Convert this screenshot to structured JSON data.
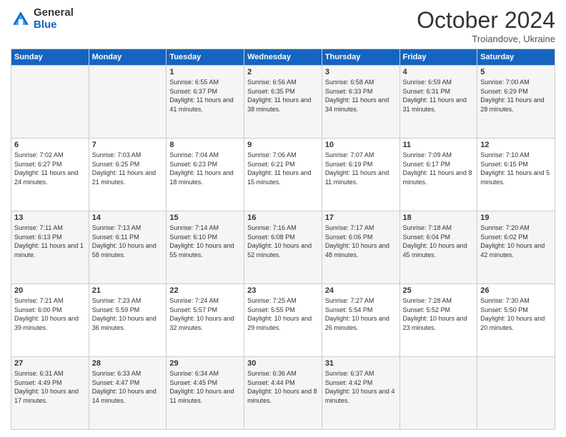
{
  "header": {
    "logo_general": "General",
    "logo_blue": "Blue",
    "month_title": "October 2024",
    "subtitle": "Troiandove, Ukraine"
  },
  "weekdays": [
    "Sunday",
    "Monday",
    "Tuesday",
    "Wednesday",
    "Thursday",
    "Friday",
    "Saturday"
  ],
  "weeks": [
    [
      {
        "day": "",
        "sunrise": "",
        "sunset": "",
        "daylight": ""
      },
      {
        "day": "",
        "sunrise": "",
        "sunset": "",
        "daylight": ""
      },
      {
        "day": "1",
        "sunrise": "Sunrise: 6:55 AM",
        "sunset": "Sunset: 6:37 PM",
        "daylight": "Daylight: 11 hours and 41 minutes."
      },
      {
        "day": "2",
        "sunrise": "Sunrise: 6:56 AM",
        "sunset": "Sunset: 6:35 PM",
        "daylight": "Daylight: 11 hours and 38 minutes."
      },
      {
        "day": "3",
        "sunrise": "Sunrise: 6:58 AM",
        "sunset": "Sunset: 6:33 PM",
        "daylight": "Daylight: 11 hours and 34 minutes."
      },
      {
        "day": "4",
        "sunrise": "Sunrise: 6:59 AM",
        "sunset": "Sunset: 6:31 PM",
        "daylight": "Daylight: 11 hours and 31 minutes."
      },
      {
        "day": "5",
        "sunrise": "Sunrise: 7:00 AM",
        "sunset": "Sunset: 6:29 PM",
        "daylight": "Daylight: 11 hours and 28 minutes."
      }
    ],
    [
      {
        "day": "6",
        "sunrise": "Sunrise: 7:02 AM",
        "sunset": "Sunset: 6:27 PM",
        "daylight": "Daylight: 11 hours and 24 minutes."
      },
      {
        "day": "7",
        "sunrise": "Sunrise: 7:03 AM",
        "sunset": "Sunset: 6:25 PM",
        "daylight": "Daylight: 11 hours and 21 minutes."
      },
      {
        "day": "8",
        "sunrise": "Sunrise: 7:04 AM",
        "sunset": "Sunset: 6:23 PM",
        "daylight": "Daylight: 11 hours and 18 minutes."
      },
      {
        "day": "9",
        "sunrise": "Sunrise: 7:06 AM",
        "sunset": "Sunset: 6:21 PM",
        "daylight": "Daylight: 11 hours and 15 minutes."
      },
      {
        "day": "10",
        "sunrise": "Sunrise: 7:07 AM",
        "sunset": "Sunset: 6:19 PM",
        "daylight": "Daylight: 11 hours and 11 minutes."
      },
      {
        "day": "11",
        "sunrise": "Sunrise: 7:09 AM",
        "sunset": "Sunset: 6:17 PM",
        "daylight": "Daylight: 11 hours and 8 minutes."
      },
      {
        "day": "12",
        "sunrise": "Sunrise: 7:10 AM",
        "sunset": "Sunset: 6:15 PM",
        "daylight": "Daylight: 11 hours and 5 minutes."
      }
    ],
    [
      {
        "day": "13",
        "sunrise": "Sunrise: 7:11 AM",
        "sunset": "Sunset: 6:13 PM",
        "daylight": "Daylight: 11 hours and 1 minute."
      },
      {
        "day": "14",
        "sunrise": "Sunrise: 7:13 AM",
        "sunset": "Sunset: 6:11 PM",
        "daylight": "Daylight: 10 hours and 58 minutes."
      },
      {
        "day": "15",
        "sunrise": "Sunrise: 7:14 AM",
        "sunset": "Sunset: 6:10 PM",
        "daylight": "Daylight: 10 hours and 55 minutes."
      },
      {
        "day": "16",
        "sunrise": "Sunrise: 7:16 AM",
        "sunset": "Sunset: 6:08 PM",
        "daylight": "Daylight: 10 hours and 52 minutes."
      },
      {
        "day": "17",
        "sunrise": "Sunrise: 7:17 AM",
        "sunset": "Sunset: 6:06 PM",
        "daylight": "Daylight: 10 hours and 48 minutes."
      },
      {
        "day": "18",
        "sunrise": "Sunrise: 7:18 AM",
        "sunset": "Sunset: 6:04 PM",
        "daylight": "Daylight: 10 hours and 45 minutes."
      },
      {
        "day": "19",
        "sunrise": "Sunrise: 7:20 AM",
        "sunset": "Sunset: 6:02 PM",
        "daylight": "Daylight: 10 hours and 42 minutes."
      }
    ],
    [
      {
        "day": "20",
        "sunrise": "Sunrise: 7:21 AM",
        "sunset": "Sunset: 6:00 PM",
        "daylight": "Daylight: 10 hours and 39 minutes."
      },
      {
        "day": "21",
        "sunrise": "Sunrise: 7:23 AM",
        "sunset": "Sunset: 5:59 PM",
        "daylight": "Daylight: 10 hours and 36 minutes."
      },
      {
        "day": "22",
        "sunrise": "Sunrise: 7:24 AM",
        "sunset": "Sunset: 5:57 PM",
        "daylight": "Daylight: 10 hours and 32 minutes."
      },
      {
        "day": "23",
        "sunrise": "Sunrise: 7:25 AM",
        "sunset": "Sunset: 5:55 PM",
        "daylight": "Daylight: 10 hours and 29 minutes."
      },
      {
        "day": "24",
        "sunrise": "Sunrise: 7:27 AM",
        "sunset": "Sunset: 5:54 PM",
        "daylight": "Daylight: 10 hours and 26 minutes."
      },
      {
        "day": "25",
        "sunrise": "Sunrise: 7:28 AM",
        "sunset": "Sunset: 5:52 PM",
        "daylight": "Daylight: 10 hours and 23 minutes."
      },
      {
        "day": "26",
        "sunrise": "Sunrise: 7:30 AM",
        "sunset": "Sunset: 5:50 PM",
        "daylight": "Daylight: 10 hours and 20 minutes."
      }
    ],
    [
      {
        "day": "27",
        "sunrise": "Sunrise: 6:31 AM",
        "sunset": "Sunset: 4:49 PM",
        "daylight": "Daylight: 10 hours and 17 minutes."
      },
      {
        "day": "28",
        "sunrise": "Sunrise: 6:33 AM",
        "sunset": "Sunset: 4:47 PM",
        "daylight": "Daylight: 10 hours and 14 minutes."
      },
      {
        "day": "29",
        "sunrise": "Sunrise: 6:34 AM",
        "sunset": "Sunset: 4:45 PM",
        "daylight": "Daylight: 10 hours and 11 minutes."
      },
      {
        "day": "30",
        "sunrise": "Sunrise: 6:36 AM",
        "sunset": "Sunset: 4:44 PM",
        "daylight": "Daylight: 10 hours and 8 minutes."
      },
      {
        "day": "31",
        "sunrise": "Sunrise: 6:37 AM",
        "sunset": "Sunset: 4:42 PM",
        "daylight": "Daylight: 10 hours and 4 minutes."
      },
      {
        "day": "",
        "sunrise": "",
        "sunset": "",
        "daylight": ""
      },
      {
        "day": "",
        "sunrise": "",
        "sunset": "",
        "daylight": ""
      }
    ]
  ]
}
